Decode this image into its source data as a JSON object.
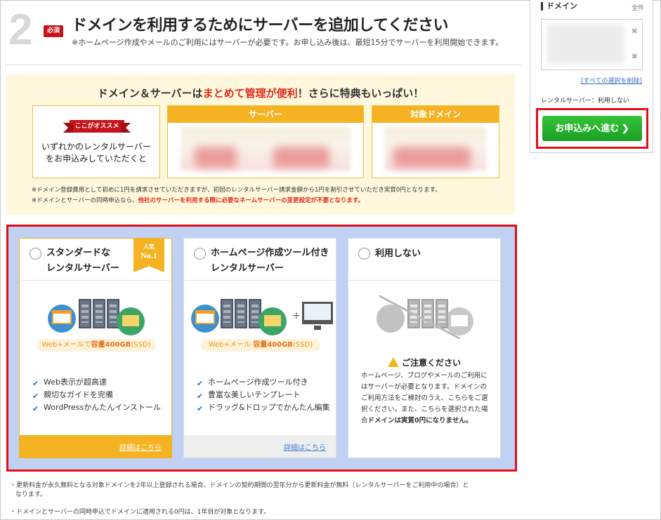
{
  "step": {
    "number": "2",
    "badge": "必須",
    "title": "ドメインを利用するためにサーバーを追加してください",
    "subtitle": "※ホームページ作成やメールのご利用にはサーバーが必要です。お申し込み後は、最短15分でサーバーを利用開始できます。"
  },
  "promo": {
    "title_pre": "ドメイン＆サーバーは",
    "title_hl": "まとめて管理が便利",
    "title_post": "！さらに特典もいっぱい！",
    "recommend_ribbon": "ここがオススメ",
    "recommend_text_1": "いずれかのレンタルサーバー",
    "recommend_text_2": "をお申込みしていただくと",
    "col_server": "サーバー",
    "col_domain": "対象ドメイン",
    "note1": "※ドメイン登録費用として初めに1円を請求させていただきますが、初回のレンタルサーバー請求金額から1円を割引させていただき実質0円となります。",
    "note2_pre": "※ドメインとサーバーの同時申込なら、",
    "note2_hl": "他社のサーバーを利用する際に必要なネームサーバーの変更設定が不要となります。"
  },
  "plans": {
    "standard": {
      "title_1": "スタンダードな",
      "title_2": "レンタルサーバー",
      "badge_small": "人気",
      "badge_big": "No.1",
      "pill_pre": "Web+メールで",
      "pill_bold": "容量400GB",
      "pill_post": "(SSD)",
      "features": [
        "Web表示が超高速",
        "親切なガイドを完備",
        "WordPressかんたんインストール"
      ],
      "link": "詳細はこちら"
    },
    "builder": {
      "title_1": "ホームページ作成ツール付き",
      "title_2": "レンタルサーバー",
      "pill_pre": "Web+メール ",
      "pill_bold": "容量400GB",
      "pill_post": "(SSD)",
      "features": [
        "ホームページ作成ツール付き",
        "豊富な美しいテンプレート",
        "ドラッグ&ドロップでかんたん編集"
      ],
      "link": "詳細はこちら"
    },
    "none": {
      "title": "利用しない",
      "caution_title": "ご注意ください",
      "caution_text": "ホームページ、ブログやメールのご利用にはサーバーが必要となります。ドメインのご利用方法をご検討のうえ、こちらをご選択ください。また、こちらを選択された場合",
      "caution_bold": "ドメインは実質0円になりません。"
    }
  },
  "footnotes": {
    "line1": "・更新料金が永久無料となる対象ドメインを2年以上登録される場合、ドメインの契約期間の翌年分から更新料金が無料（レンタルサーバーをご利用中の場合）と",
    "line1b": "なります。",
    "line2": "・ドメインとサーバーの同時申込でドメインに適用される0円は、1年目が対象となります。"
  },
  "sidebar": {
    "label": "ドメイン",
    "all": "全件",
    "clear": "[すべての選択を削除]",
    "rental": "レンタルサーバー：利用しない",
    "apply": "お申込みへ進む ❯"
  }
}
